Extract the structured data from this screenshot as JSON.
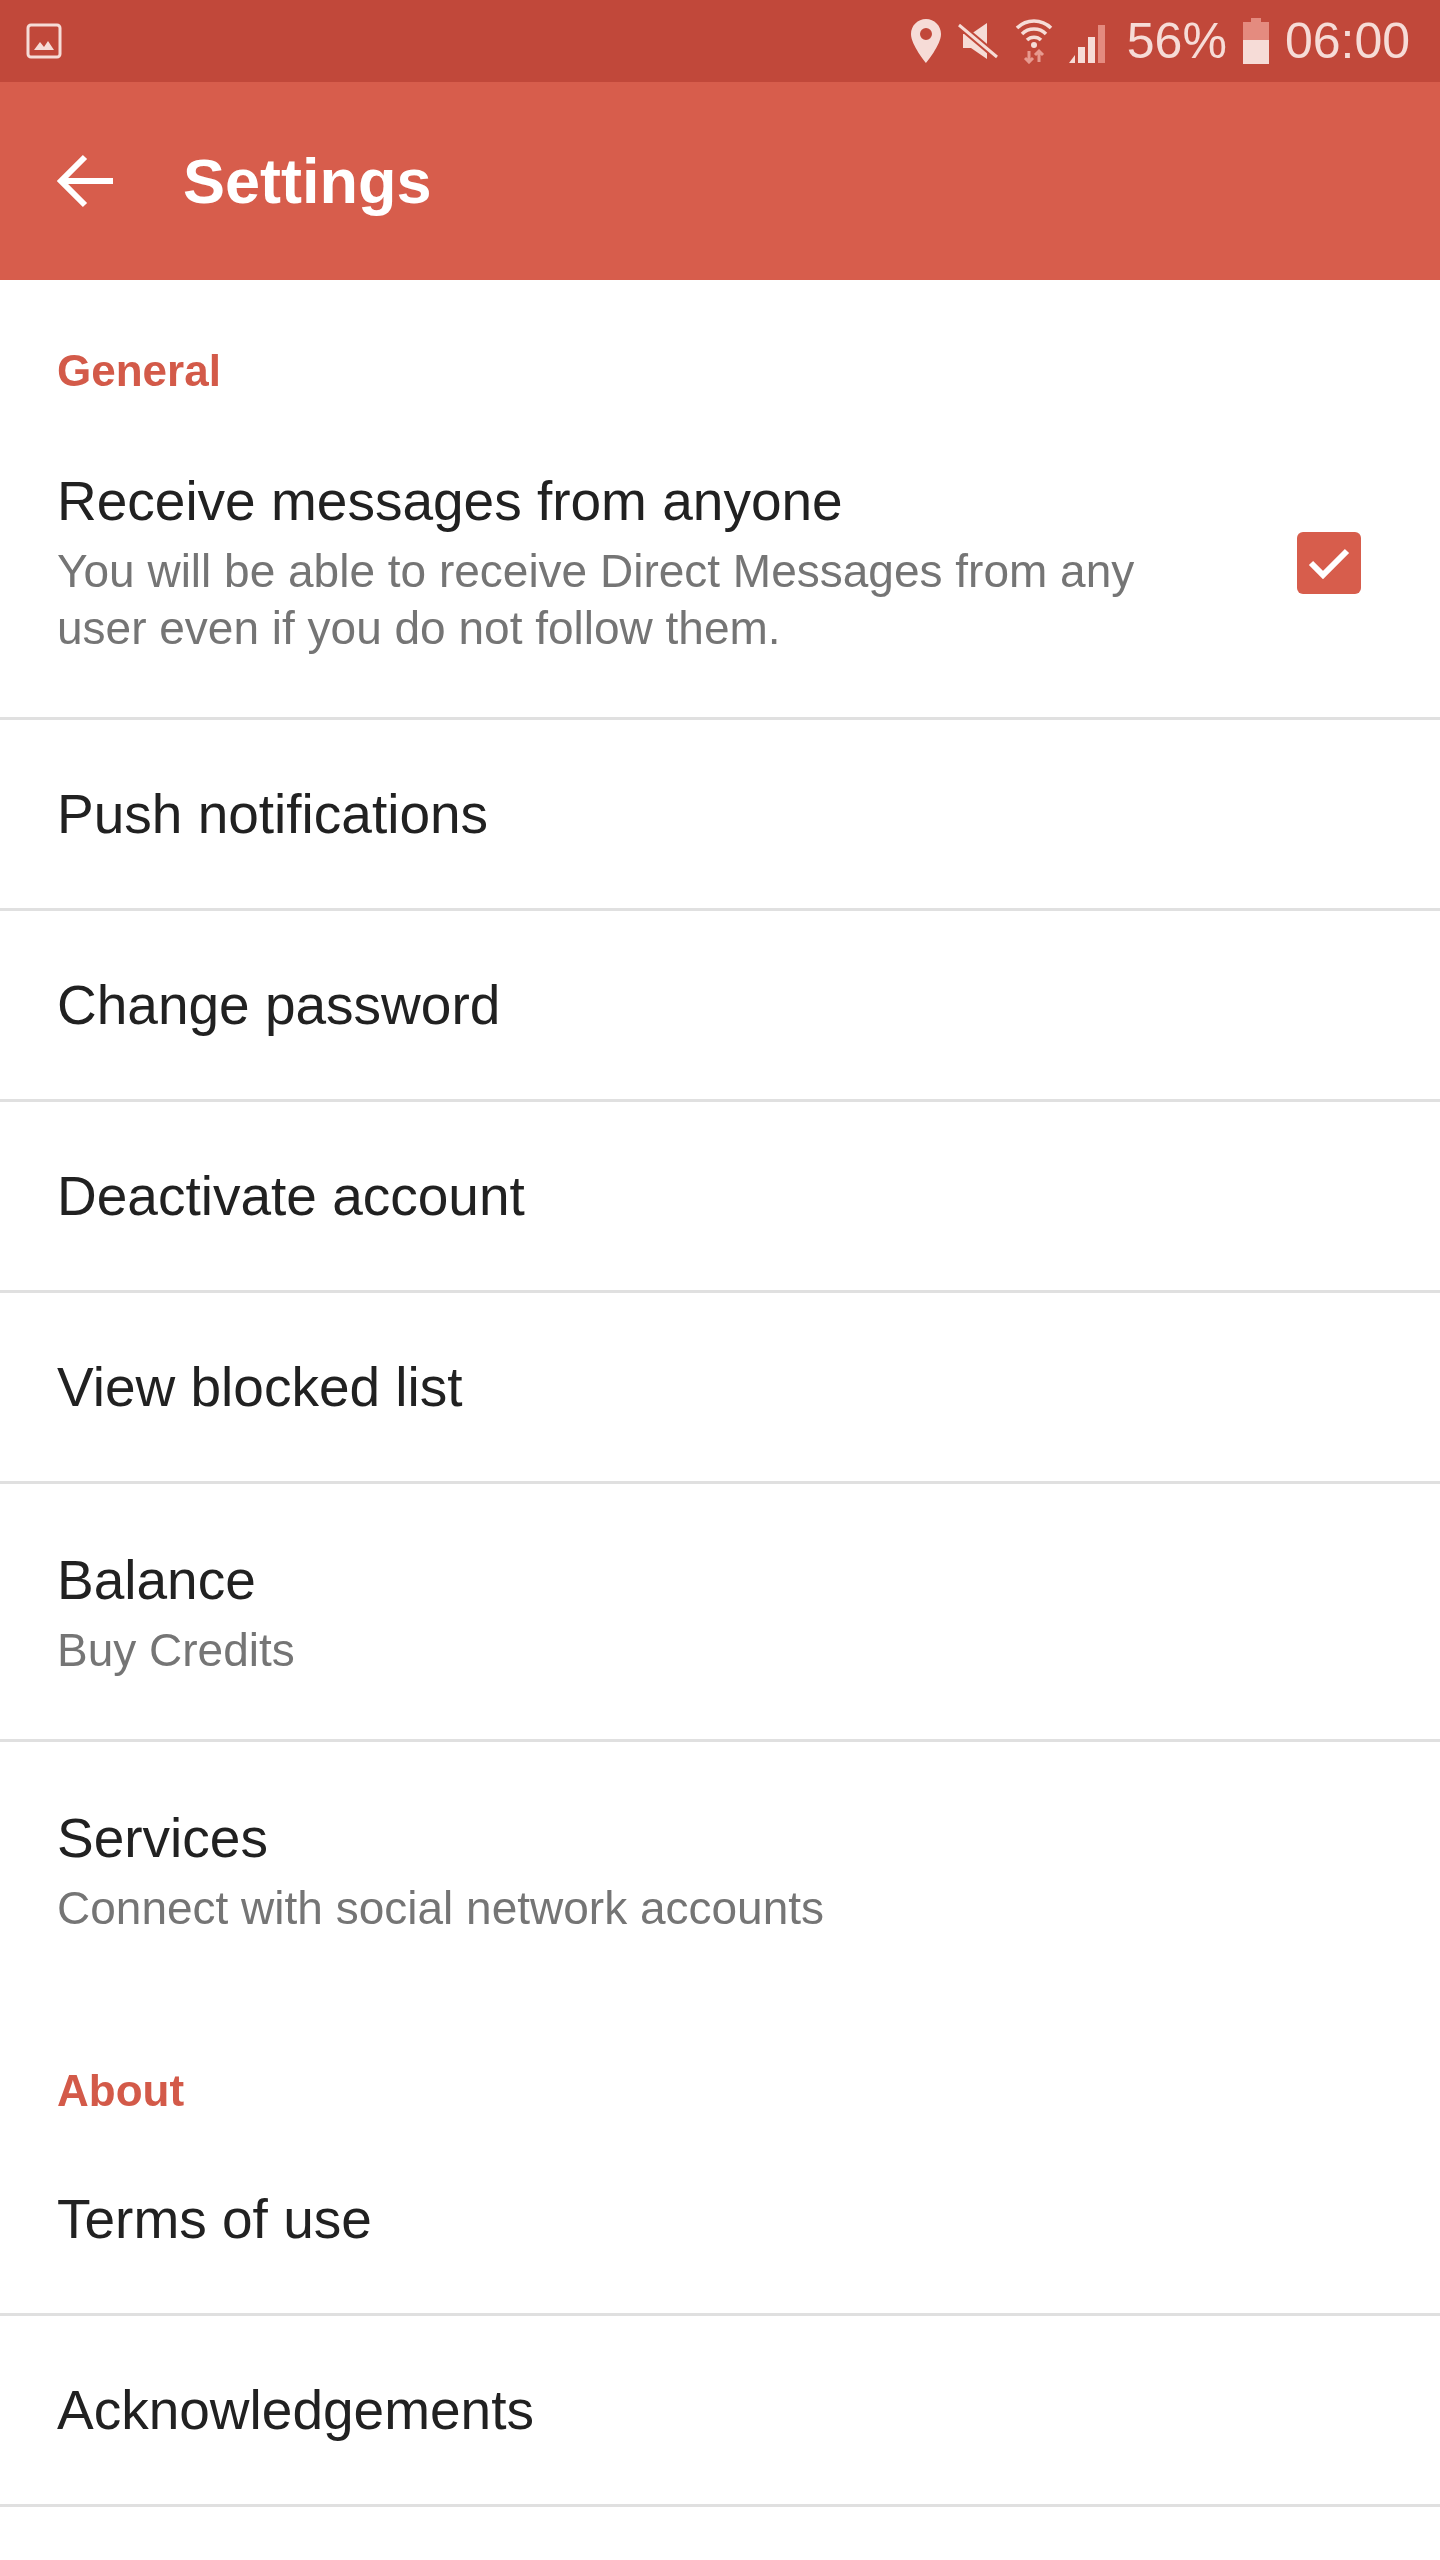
{
  "status_bar": {
    "battery_percent": "56%",
    "time": "06:00"
  },
  "app_bar": {
    "title": "Settings"
  },
  "sections": [
    {
      "header": "General",
      "items": [
        {
          "kind": "checkbox",
          "title": "Receive messages from anyone",
          "subtitle": "You will be able to receive Direct Messages from any user even if you do not follow them.",
          "checked": true
        },
        {
          "kind": "plain",
          "title": "Push notifications"
        },
        {
          "kind": "plain",
          "title": "Change password"
        },
        {
          "kind": "plain",
          "title": "Deactivate account"
        },
        {
          "kind": "plain",
          "title": "View blocked list"
        },
        {
          "kind": "plain",
          "title": "Balance",
          "subtitle": "Buy Credits"
        },
        {
          "kind": "plain",
          "title": "Services",
          "subtitle": "Connect with social network accounts"
        }
      ]
    },
    {
      "header": "About",
      "items": [
        {
          "kind": "plain",
          "title": "Terms of use"
        },
        {
          "kind": "plain",
          "title": "Acknowledgements"
        }
      ]
    }
  ]
}
